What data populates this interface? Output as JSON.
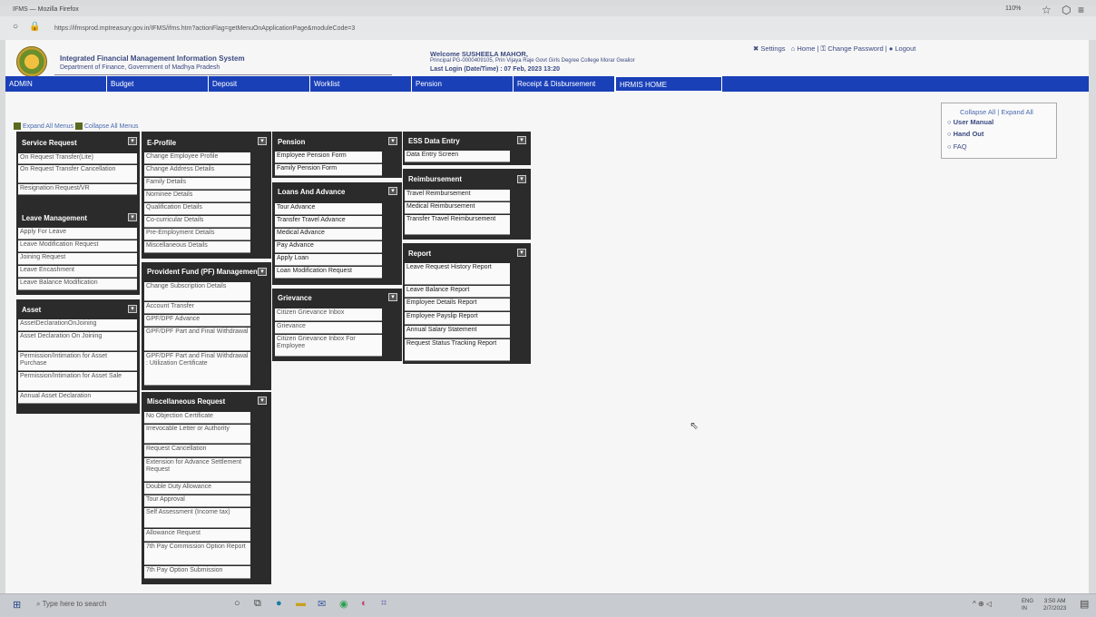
{
  "browser": {
    "title": "IFMS — Mozilla Firefox",
    "url": "https://ifmsprod.mptreasury.gov.in/IFMS/ifms.htm?actionFlag=getMenuOnApplicationPage&moduleCode=3",
    "zoom": "110%"
  },
  "header": {
    "title": "Integrated Financial Management Information System",
    "subtitle": "Department of Finance, Government of Madhya Pradesh",
    "welcome": "Welcome SUSHEELA MAHOR,",
    "principal": "Principal PG-0000409105, Prin Vijaya Raje Govt Girls Degree College Morar Gwalior",
    "last_login": "Last Login (Date/Time) :  07 Feb, 2023 13:20",
    "links": {
      "settings": "Settings",
      "home": "Home",
      "change_password": "Change Password",
      "logout": "Logout"
    }
  },
  "nav": {
    "tabs": [
      "ADMIN",
      "Budget",
      "Deposit",
      "Worklist",
      "Pension",
      "Receipt & Disbursement"
    ],
    "hrmis": "HRMIS HOME"
  },
  "expand_all": "Expand All Menus",
  "collapse_all": "Collapse All Menus",
  "right_box": {
    "collapse_all": "Collapse All",
    "separator": "|",
    "expand_all": "Expand All",
    "links": [
      "User Manual",
      "Hand Out",
      "FAQ"
    ]
  },
  "panels": {
    "service_request": {
      "title": "Service Request",
      "items": [
        "On Request Transfer(Lite)",
        "On Request Transfer Cancellation",
        "Resignation Request/VR"
      ]
    },
    "leave_management": {
      "title": "Leave Management",
      "items": [
        "Apply For Leave",
        "Leave Modification Request",
        "Joining Request",
        "Leave Encashment",
        "Leave Balance Modification"
      ]
    },
    "asset": {
      "title": "Asset",
      "items": [
        "AssetDeclarationOnJoining",
        "Asset Declaration On Joining",
        "Permission/Intimation for Asset Purchase",
        "Permission/Intimation for Asset Sale",
        "Annual Asset Declaration"
      ]
    },
    "eprofile": {
      "title": "E-Profile",
      "items": [
        "Change Employee Profile",
        "Change Address Details",
        "Family Details",
        "Nominee Details",
        "Qualification Details",
        "Co-curricular Details",
        "Pre-Employment Details",
        "Miscellaneous Details"
      ]
    },
    "pf": {
      "title": "Provident Fund (PF) Management",
      "items": [
        "Change Subscription Details",
        "Account Transfer",
        "GPF/DPF Advance",
        "GPF/DPF Part and Final Withdrawal",
        "GPF/DPF Part and Final Withdrawal : Utilization Certificate"
      ]
    },
    "misc": {
      "title": "Miscellaneous Request",
      "items": [
        "No Objection Certificate",
        "Irrevocable Letter or Authority",
        "Request Cancellation",
        "Extension for Advance Settlement Request",
        "Double Duty Allowance",
        "Tour Approval",
        "Self Assessment (Income tax)",
        "Allowance Request",
        "7th Pay Commission Option Report",
        "7th Pay Option Submission"
      ]
    },
    "pension": {
      "title": "Pension",
      "items": [
        "Employee Pension Form",
        "Family Pension Form"
      ]
    },
    "loans": {
      "title": "Loans And Advance",
      "items": [
        "Tour Advance",
        "Transfer Travel Advance",
        "Medical Advance",
        "Pay Advance",
        "Apply Loan",
        "Loan Modification Request"
      ]
    },
    "grievance": {
      "title": "Grievance",
      "items": [
        "Citizen Grievance Inbox",
        "Grievance",
        "Citizen Grievance Inbox For Employee"
      ]
    },
    "ess": {
      "title": "ESS Data Entry",
      "items": [
        "Data Entry Screen"
      ]
    },
    "reimbursement": {
      "title": "Reimbursement",
      "items": [
        "Travel Reimbursement",
        "Medical Reimbursement",
        "Transfer Travel Reimbursement"
      ]
    },
    "report": {
      "title": "Report",
      "items": [
        "Leave Request History Report",
        "Leave Balance Report",
        "Employee Details Report",
        "Employee Payslip Report",
        "Annual Salary Statement",
        "Request Status Tracking Report"
      ]
    }
  },
  "taskbar": {
    "search_placeholder": "Type here to search",
    "lang": "ENG",
    "region": "IN",
    "time": "3:50 AM",
    "date": "2/7/2023"
  }
}
